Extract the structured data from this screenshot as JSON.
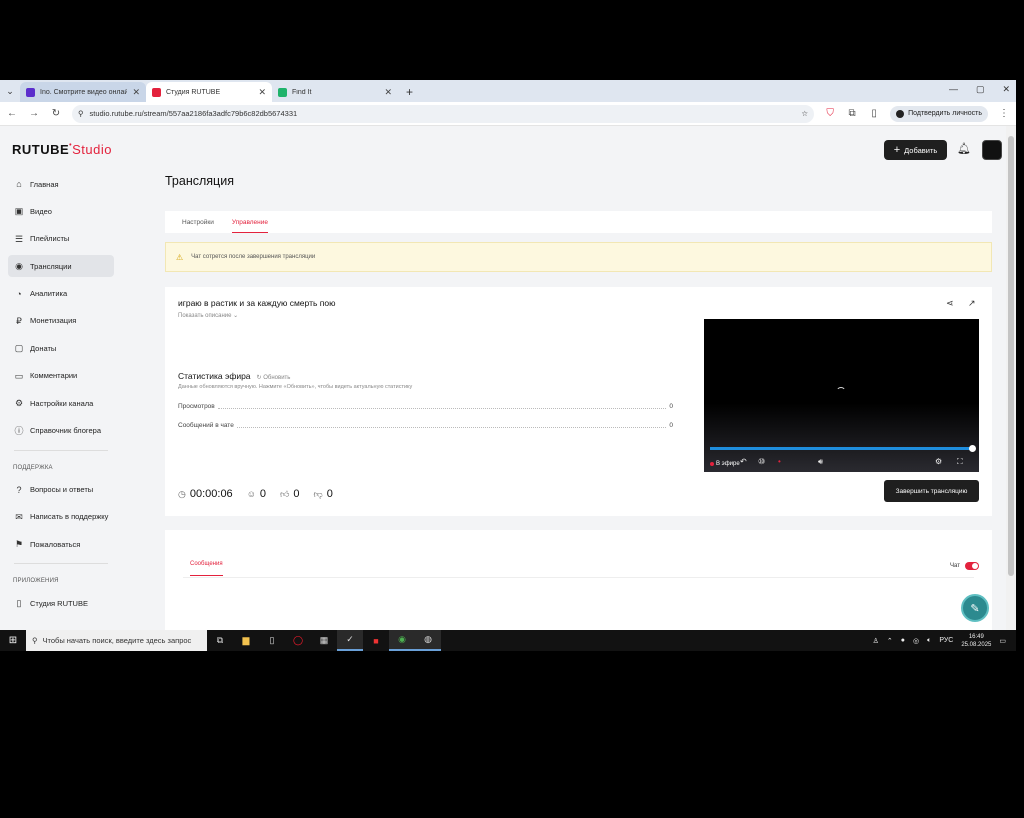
{
  "browser": {
    "tabs": [
      {
        "title": "Ino. Смотрите видео онлайн",
        "active": false,
        "favicon_color": "#5b2ecc"
      },
      {
        "title": "Студия RUTUBE",
        "active": true,
        "favicon_color": "#e3223d"
      },
      {
        "title": "Find It",
        "active": false,
        "favicon_color": "#1fb36b"
      }
    ],
    "url": "studio.rutube.ru/stream/557aa2186fa3adfc79b6c82db5674331",
    "verify_label": "Подтвердить личность"
  },
  "app": {
    "logo_main": "RUTUBE",
    "logo_sub": "Studio",
    "add_button": "Добавить",
    "accent": "#e3223d"
  },
  "sidebar": {
    "items": [
      {
        "label": "Главная",
        "icon": "home-icon",
        "glyph": "⌂"
      },
      {
        "label": "Видео",
        "icon": "video-icon",
        "glyph": "▣"
      },
      {
        "label": "Плейлисты",
        "icon": "playlist-icon",
        "glyph": "☰"
      },
      {
        "label": "Трансляции",
        "icon": "broadcast-icon",
        "glyph": "◉",
        "active": true
      },
      {
        "label": "Аналитика",
        "icon": "analytics-icon",
        "glyph": "◔"
      },
      {
        "label": "Монетизация",
        "icon": "money-icon",
        "glyph": "₽"
      },
      {
        "label": "Донаты",
        "icon": "donate-icon",
        "glyph": "▢"
      },
      {
        "label": "Комментарии",
        "icon": "comments-icon",
        "glyph": "▭"
      },
      {
        "label": "Настройки канала",
        "icon": "gear-icon",
        "glyph": "⚙"
      },
      {
        "label": "Справочник блогера",
        "icon": "info-icon",
        "glyph": "ⓘ"
      }
    ],
    "support_heading": "ПОДДЕРЖКА",
    "support_items": [
      {
        "label": "Вопросы и ответы",
        "icon": "question-icon",
        "glyph": "?"
      },
      {
        "label": "Написать в поддержку",
        "icon": "mail-icon",
        "glyph": "✉"
      },
      {
        "label": "Пожаловаться",
        "icon": "flag-icon",
        "glyph": "⚑"
      }
    ],
    "apps_heading": "ПРИЛОЖЕНИЯ",
    "apps_items": [
      {
        "label": "Студия RUTUBE",
        "icon": "app-icon",
        "glyph": "▯"
      }
    ]
  },
  "main": {
    "title": "Трансляция",
    "tabs": [
      {
        "label": "Настройки",
        "active": false
      },
      {
        "label": "Управление",
        "active": true
      }
    ],
    "warning": "Чат сотрется после завершения трансляции",
    "stream_title": "играю в растик и за каждую смерть пою",
    "show_description": "Показать описание ⌄",
    "stats_title": "Статистика эфира",
    "stats_refresh": "Обновить",
    "stats_note": "Данные обновляются вручную. Нажмите «Обновить», чтобы видеть актуальную статистику",
    "stats": [
      {
        "label": "Просмотров",
        "value": "0"
      },
      {
        "label": "Сообщений в чате",
        "value": "0"
      }
    ],
    "duration": "00:00:06",
    "viewers": "0",
    "likes": "0",
    "dislikes": "0",
    "live_label": "В эфире",
    "end_button": "Завершить трансляцию",
    "messages_tab": "Сообщения",
    "chat_label": "Чат",
    "progress_fraction": 1.0
  },
  "taskbar": {
    "search_placeholder": "Чтобы начать поиск, введите здесь запрос",
    "lang": "РУС",
    "time": "16:49",
    "date": "25.08.2025"
  }
}
